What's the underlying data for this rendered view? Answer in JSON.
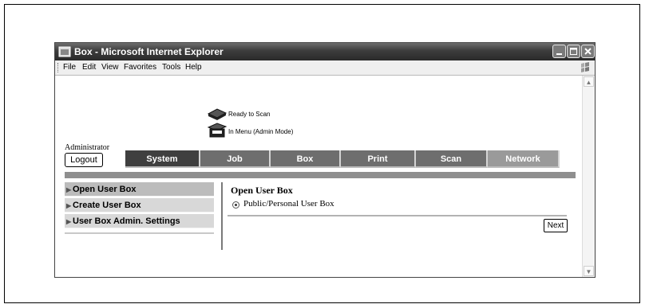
{
  "window": {
    "title": "Box - Microsoft Internet Explorer"
  },
  "menubar": {
    "items": [
      "File",
      "Edit",
      "View",
      "Favorites",
      "Tools",
      "Help"
    ]
  },
  "status": {
    "ready": "Ready to Scan",
    "mode": "In Menu (Admin Mode)"
  },
  "user": {
    "role": "Administrator",
    "logout_label": "Logout"
  },
  "tabs": [
    "System",
    "Job",
    "Box",
    "Print",
    "Scan",
    "Network"
  ],
  "sidebar": {
    "items": [
      "Open User Box",
      "Create User Box",
      "User Box Admin. Settings"
    ]
  },
  "panel": {
    "title": "Open User Box",
    "option_label": "Public/Personal User Box",
    "next_label": "Next"
  },
  "icons": {
    "title_icon": "ie-window-icon",
    "xp_logo": "windows-flag-icon",
    "device": "scanner-icon",
    "scroll_up": "scroll-up-icon",
    "scroll_down": "scroll-down-icon"
  }
}
